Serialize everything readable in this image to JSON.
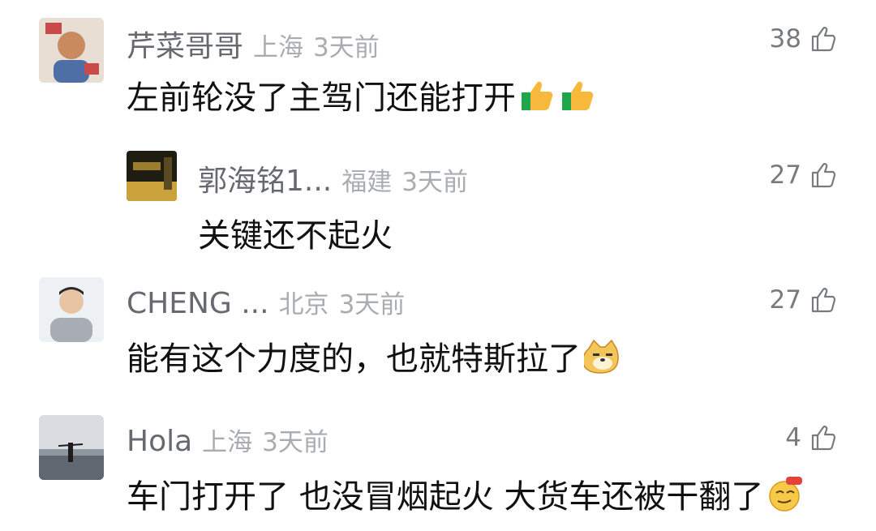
{
  "comments": [
    {
      "name": "芹菜哥哥",
      "location": "上海",
      "time": "3天前",
      "likes": "38",
      "text": "左前轮没了主驾门还能打开",
      "emojis": [
        "thumbs-up-emoji",
        "thumbs-up-emoji"
      ]
    },
    {
      "name": "郭海铭1...",
      "location": "福建",
      "time": "3天前",
      "likes": "27",
      "text": "关键还不起火",
      "is_reply": true
    },
    {
      "name": "CHENG ...",
      "location": "北京",
      "time": "3天前",
      "likes": "27",
      "text": "能有这个力度的，也就特斯拉了",
      "emojis": [
        "doge-emoji"
      ]
    },
    {
      "name": "Hola",
      "location": "上海",
      "time": "3天前",
      "likes": "4",
      "text": "车门打开了 也没冒烟起火 大货车还被干翻了",
      "emojis": [
        "666-emoji"
      ]
    }
  ],
  "icons": {
    "like": "thumbs-up-outline-icon"
  },
  "colors": {
    "name": "#666a70",
    "meta": "#a9acb1",
    "text": "#111111"
  }
}
